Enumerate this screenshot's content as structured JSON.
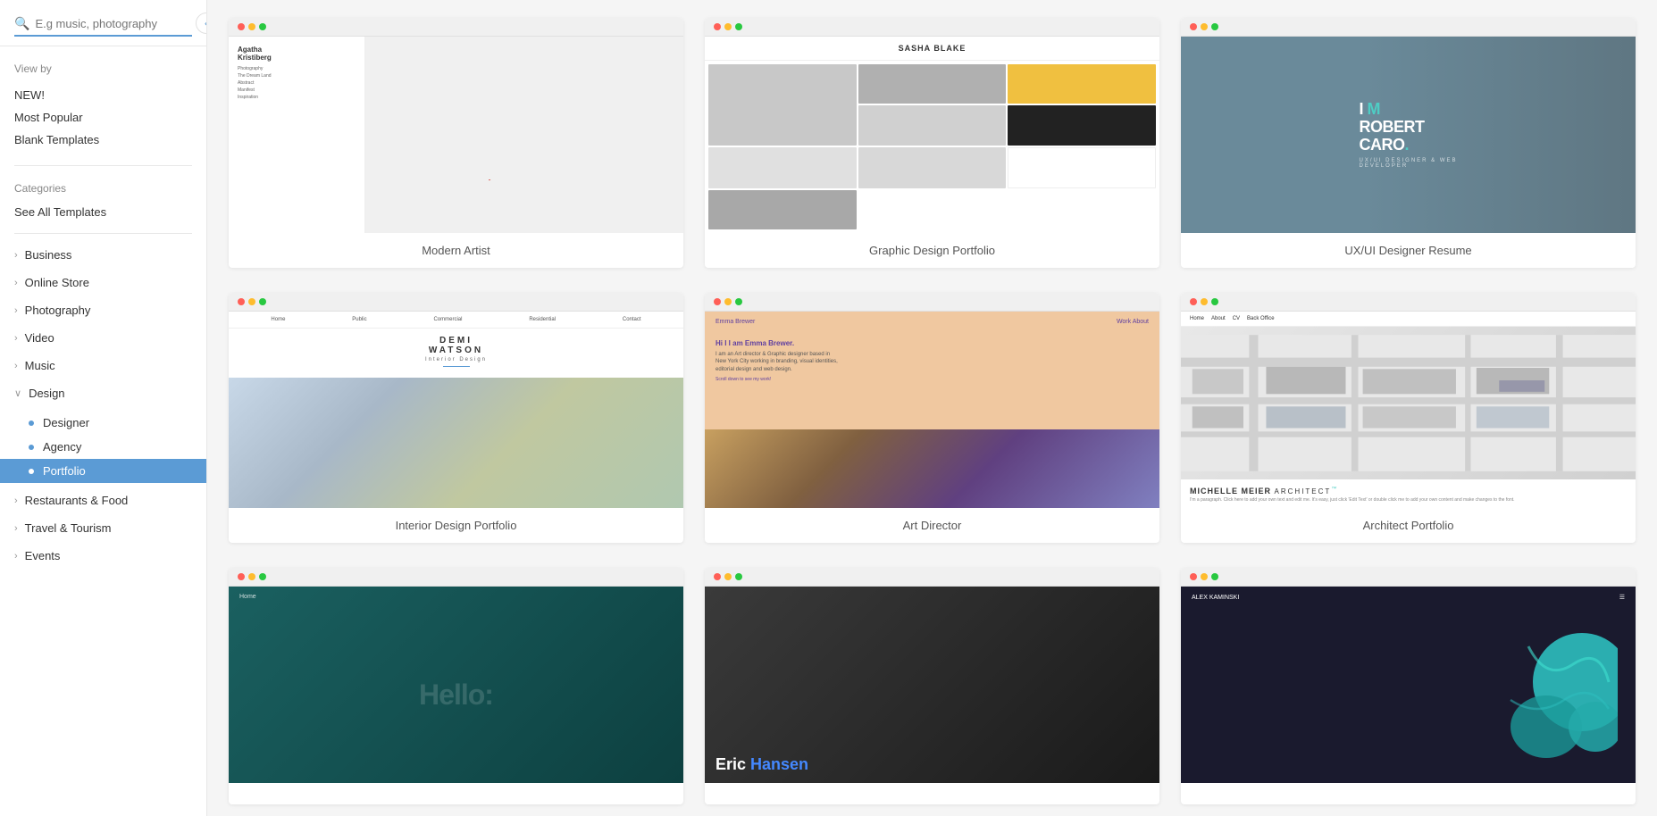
{
  "sidebar": {
    "collapse_btn": "‹",
    "search_placeholder": "E.g music, photography",
    "view_by_label": "View by",
    "view_items": [
      {
        "id": "new",
        "label": "NEW!"
      },
      {
        "id": "most-popular",
        "label": "Most Popular"
      },
      {
        "id": "blank-templates",
        "label": "Blank Templates"
      }
    ],
    "categories_label": "Categories",
    "see_all_label": "See All Templates",
    "nav_items": [
      {
        "id": "business",
        "label": "Business",
        "expanded": false
      },
      {
        "id": "online-store",
        "label": "Online Store",
        "expanded": false
      },
      {
        "id": "photography",
        "label": "Photography",
        "expanded": false
      },
      {
        "id": "video",
        "label": "Video",
        "expanded": false
      },
      {
        "id": "music",
        "label": "Music",
        "expanded": false
      },
      {
        "id": "design",
        "label": "Design",
        "expanded": true,
        "sub_items": [
          {
            "id": "designer",
            "label": "Designer"
          },
          {
            "id": "agency",
            "label": "Agency"
          },
          {
            "id": "portfolio",
            "label": "Portfolio",
            "active": true
          }
        ]
      },
      {
        "id": "restaurants",
        "label": "Restaurants & Food",
        "expanded": false
      },
      {
        "id": "travel",
        "label": "Travel & Tourism",
        "expanded": false
      },
      {
        "id": "events",
        "label": "Events",
        "expanded": false
      }
    ]
  },
  "templates": [
    {
      "id": "modern-artist",
      "name": "Modern Artist",
      "type": "modern-artist"
    },
    {
      "id": "graphic-design-portfolio",
      "name": "Graphic Design Portfolio",
      "type": "graphic-design"
    },
    {
      "id": "ux-designer-resume",
      "name": "UX/UI Designer Resume",
      "type": "robert-caro"
    },
    {
      "id": "interior-design-portfolio",
      "name": "Interior Design Portfolio",
      "type": "interior"
    },
    {
      "id": "art-director",
      "name": "Art Director",
      "type": "art-director"
    },
    {
      "id": "architect-portfolio",
      "name": "Architect Portfolio",
      "type": "architect"
    },
    {
      "id": "hello",
      "name": "",
      "type": "hello"
    },
    {
      "id": "eric-hansen",
      "name": "",
      "type": "eric-hansen"
    },
    {
      "id": "alex-kaminski",
      "name": "",
      "type": "alex-kaminski"
    }
  ],
  "preview_texts": {
    "modern_artist_name": "Agatha Kristiberg",
    "sasha_blake": "SASHA BLAKE",
    "robert_caro_line1": "I M",
    "robert_caro_line2": "ROBERT",
    "robert_caro_line3": "CARO.",
    "robert_caro_sub": "UX/UI DESIGNER & WEB DEVELOPER",
    "demi_watson_line1": "DEMI",
    "demi_watson_line2": "WATSON",
    "demi_watson_sub": "Interior Design",
    "emma_brewer": "Emma Brewer",
    "emma_work_about": "Work  About",
    "emma_intro": "Hi I I am Emma Brewer.\nI am an Art director & Graphic designer based in\nNew York City working in branding, visual identities,\neditorial design and web design.",
    "emma_scroll": "Scroll down to see my work!",
    "michelle_meier": "MICHELLE MEIER",
    "architect_word": "ARCHITECT",
    "hello_nav": "Home",
    "hello_text": "Hello:",
    "eric_hansen": "Eric Hansen",
    "alex_name": "ALEX KAMINSKI"
  }
}
